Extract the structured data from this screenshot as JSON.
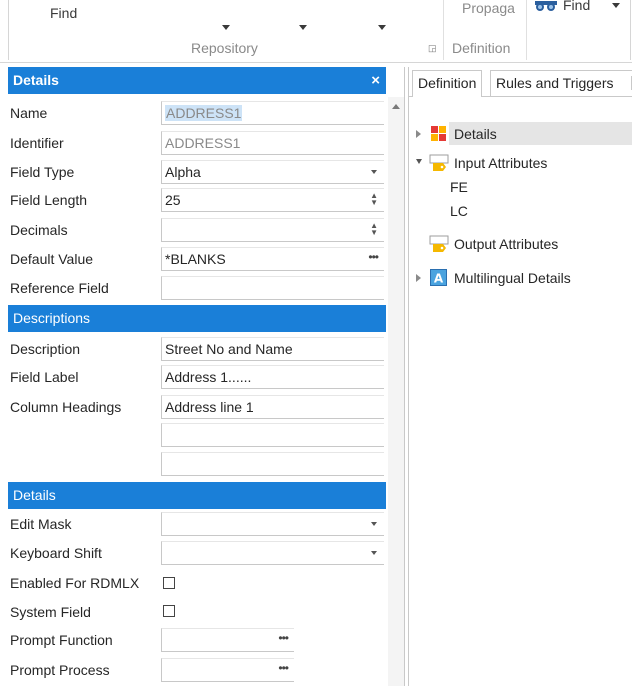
{
  "ribbon": {
    "find_left": "Find",
    "repository_group": "Repository",
    "definition_group": "Definition",
    "propagate_label": "Propaga",
    "find_right": "Find"
  },
  "details_panel": {
    "title": "Details",
    "close_glyph": "×",
    "fields": {
      "name": {
        "label": "Name",
        "value": "ADDRESS1"
      },
      "identifier": {
        "label": "Identifier",
        "value": "ADDRESS1"
      },
      "field_type": {
        "label": "Field Type",
        "value": "Alpha"
      },
      "field_length": {
        "label": "Field Length",
        "value": "25"
      },
      "decimals": {
        "label": "Decimals",
        "value": ""
      },
      "default_value": {
        "label": "Default Value",
        "value": "*BLANKS"
      },
      "reference_field": {
        "label": "Reference Field",
        "value": ""
      }
    },
    "descriptions_header": "Descriptions",
    "descriptions": {
      "description": {
        "label": "Description",
        "value": "Street No and Name"
      },
      "field_label": {
        "label": "Field Label",
        "value": "Address 1......"
      },
      "column_headings": {
        "label": "Column Headings",
        "values": [
          "Address line 1",
          "",
          ""
        ]
      }
    },
    "details2_header": "Details",
    "details2": {
      "edit_mask": {
        "label": "Edit Mask",
        "value": ""
      },
      "keyboard_shift": {
        "label": "Keyboard Shift",
        "value": ""
      },
      "enabled_rdmlx": {
        "label": "Enabled For RDMLX",
        "checked": false
      },
      "system_field": {
        "label": "System Field",
        "checked": false
      },
      "prompt_function": {
        "label": "Prompt Function",
        "value": ""
      },
      "prompt_process": {
        "label": "Prompt Process",
        "value": ""
      }
    }
  },
  "right_panel": {
    "tabs": [
      "Definition",
      "Rules and Triggers"
    ],
    "active_tab": "Definition",
    "tree": {
      "details": "Details",
      "input_attributes": "Input Attributes",
      "input_children": [
        "FE",
        "LC"
      ],
      "output_attributes": "Output Attributes",
      "multilingual_details": "Multilingual Details"
    }
  },
  "colors": {
    "header_blue": "#1a7fd8",
    "selected_row": "#e5e5e5",
    "name_selection": "#cde3f7"
  }
}
